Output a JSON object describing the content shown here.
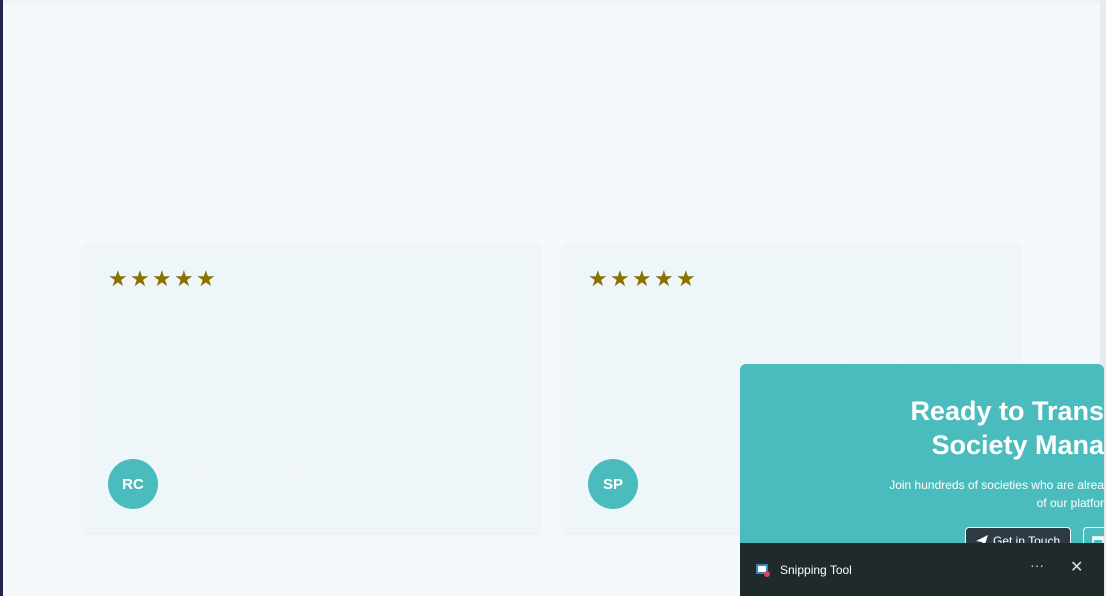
{
  "testimonials": [
    {
      "stars": "★★★★★",
      "quote": "\"Since integrating this platform, our management processes have become far more transparent and efficient. Residents appreciate the easy access to information.\"",
      "initials": "RC",
      "name": "Rajesh Chawla",
      "role": "Society President, Green Valley Apartments"
    },
    {
      "stars": "★★★★★",
      "quote": "\"Managing maintenance requests and vendor coordination has been a breeze lately. This... more convenient ... society manage...",
      "initials": "SP",
      "name": "Sarita Pa...",
      "role": "Property M..."
    }
  ],
  "cta": {
    "title": "Ready to Trans\nSociety Mana",
    "description": "Join hundreds of societies who are alrea\nof our platfor",
    "primary_button": "Get in Touch",
    "secondary_button": ""
  },
  "snipping_tool": {
    "label": "Snipping Tool",
    "more": "···",
    "close": "✕"
  },
  "colors": {
    "accent": "#4bbcbd",
    "star": "#8a7200",
    "card_bg": "#eef6f9",
    "taskbar": "#202a2d"
  }
}
